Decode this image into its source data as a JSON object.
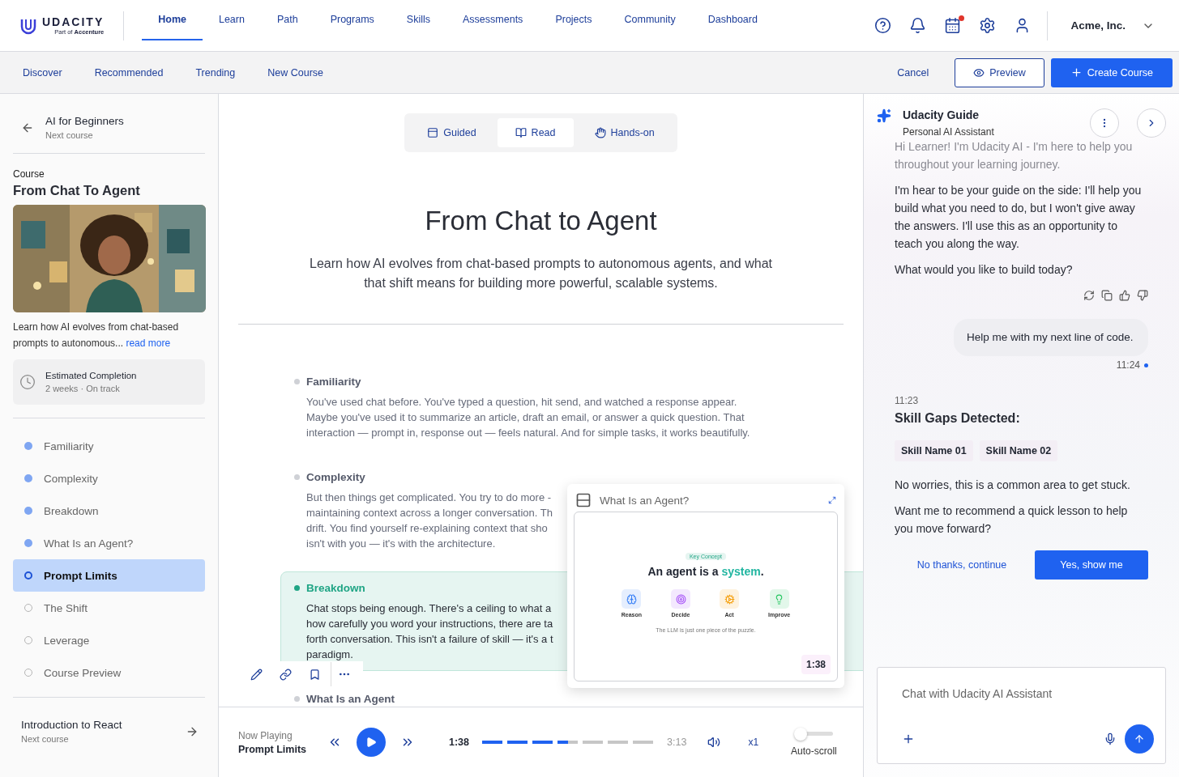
{
  "header": {
    "logo": {
      "name": "UDACITY",
      "tagline": "Part of **Accenture**"
    },
    "nav": [
      {
        "label": "Home",
        "selected": true
      },
      {
        "label": "Learn",
        "selected": false
      },
      {
        "label": "Path",
        "selected": false
      },
      {
        "label": "Programs",
        "selected": false
      },
      {
        "label": "Skills",
        "selected": false
      },
      {
        "label": "Assessments",
        "selected": false
      },
      {
        "label": "Projects",
        "selected": false
      },
      {
        "label": "Community",
        "selected": false
      },
      {
        "label": "Dashboard",
        "selected": false
      }
    ],
    "icons": [
      {
        "kind": "help",
        "alert": false
      },
      {
        "kind": "bell",
        "alert": false
      },
      {
        "kind": "calendar",
        "alert": true
      },
      {
        "kind": "settings",
        "alert": false
      },
      {
        "kind": "user",
        "alert": false
      }
    ],
    "account": "Acme, Inc."
  },
  "subnav": {
    "links": [
      "Discover",
      "Recommended",
      "Trending",
      "New Course"
    ],
    "cancel": "Cancel",
    "preview": "Preview",
    "create": "Create Course"
  },
  "sidebar": {
    "previous": {
      "title": "AI for Beginners",
      "caption": "Next course"
    },
    "course_label": "Course",
    "course_title": "From Chat To Agent",
    "description": "Learn how AI evolves from chat-based prompts to autonomous...",
    "read_more": "read more",
    "completion": {
      "title": "Estimated Completion",
      "detail": "2 weeks · On track"
    },
    "outline": [
      {
        "label": "Familiarity",
        "completed": true,
        "selected": false
      },
      {
        "label": "Complexity",
        "completed": true,
        "selected": false
      },
      {
        "label": "Breakdown",
        "completed": true,
        "selected": false
      },
      {
        "label": "What Is an Agent?",
        "completed": true,
        "selected": false
      },
      {
        "label": "Prompt Limits",
        "completed": false,
        "selected": true
      },
      {
        "label": "The Shift",
        "completed": false,
        "selected": false
      },
      {
        "label": "Leverage",
        "completed": false,
        "selected": false
      },
      {
        "label": "Course Preview",
        "completed": false,
        "selected": false
      }
    ],
    "next": {
      "title": "Introduction to React",
      "caption": "Next course"
    }
  },
  "lesson": {
    "modes": [
      {
        "label": "Guided",
        "kind": "guided",
        "selected": false
      },
      {
        "label": "Read",
        "kind": "read",
        "selected": true
      },
      {
        "label": "Hands-on",
        "kind": "hands",
        "selected": false
      }
    ],
    "title": "From Chat to Agent",
    "subtitle": "Learn how AI evolves from chat-based prompts to autonomous agents, and what that shift means for building more powerful, scalable systems.",
    "sections": [
      {
        "heading": "Familiarity",
        "active": false,
        "lines": [
          "You've used chat before. You've typed a question, hit send, and watched a response appear.",
          "Maybe you've used it to summarize an article, draft an email, or answer a quick question. That",
          "interaction — prompt in, response out — feels natural. And for simple tasks, it works beautifully."
        ]
      },
      {
        "heading": "Complexity",
        "active": false,
        "lines": [
          "But then things get complicated. You try to do more -",
          "maintaining context across a longer conversation. Th",
          "drift. You find yourself re-explaining context that sho",
          "isn't with you — it's with the architecture."
        ]
      },
      {
        "heading": "Breakdown",
        "active": true,
        "lines": [
          "Chat stops being enough. There's a ceiling to what a",
          "how carefully you word your instructions, there are ta",
          "forth conversation. This isn't a failure of skill — it's a t",
          "paradigm."
        ]
      },
      {
        "heading": "What Is an Agent",
        "active": false
      }
    ],
    "video": {
      "title": "What Is an Agent?",
      "badge": "Key Concept",
      "headline": "An agent is a **system**.",
      "steps": [
        {
          "label": "Reason",
          "kind": "brain",
          "color": "#3b82f6"
        },
        {
          "label": "Decide",
          "kind": "target",
          "color": "#a855f7"
        },
        {
          "label": "Act",
          "kind": "gear",
          "color": "#f59e0b"
        },
        {
          "label": "Improve",
          "kind": "bulb",
          "color": "#22c55e"
        }
      ],
      "caption": "The LLM is just one piece of the puzzle.",
      "time": "1:38"
    },
    "player": {
      "label": "Now Playing",
      "title": "Prompt Limits",
      "current": "1:38",
      "level": 0.5,
      "total": "3:13",
      "speed": "x1",
      "autoscroll": {
        "label": "Auto-scroll",
        "on": false
      }
    }
  },
  "assistant": {
    "title": "Udacity Guide",
    "subtitle": "Personal AI Assistant",
    "intro": [
      "Hi Learner! I'm Udacity AI - I'm here to help you throughout your learning journey.",
      "I'm hear to be your guide on the side: I'll help you build what you need to do, but I won't give away the answers. I'll use this as an opportunity to teach you along the way.",
      "What would you like to build today?"
    ],
    "user_message": "Help me with my next line of code.",
    "user_time": "11:24",
    "reply_time": "11:23",
    "gaps_title": "Skill Gaps Detected:",
    "skills": [
      "Skill Name 01",
      "Skill Name 02"
    ],
    "reply": [
      "No worries, this is a common area to get stuck.",
      "Want me to recommend a quick lesson to help you move forward?"
    ],
    "decline": "No thanks, continue",
    "accept": "Yes, show me",
    "input_placeholder": "Chat with Udacity AI Assistant"
  }
}
